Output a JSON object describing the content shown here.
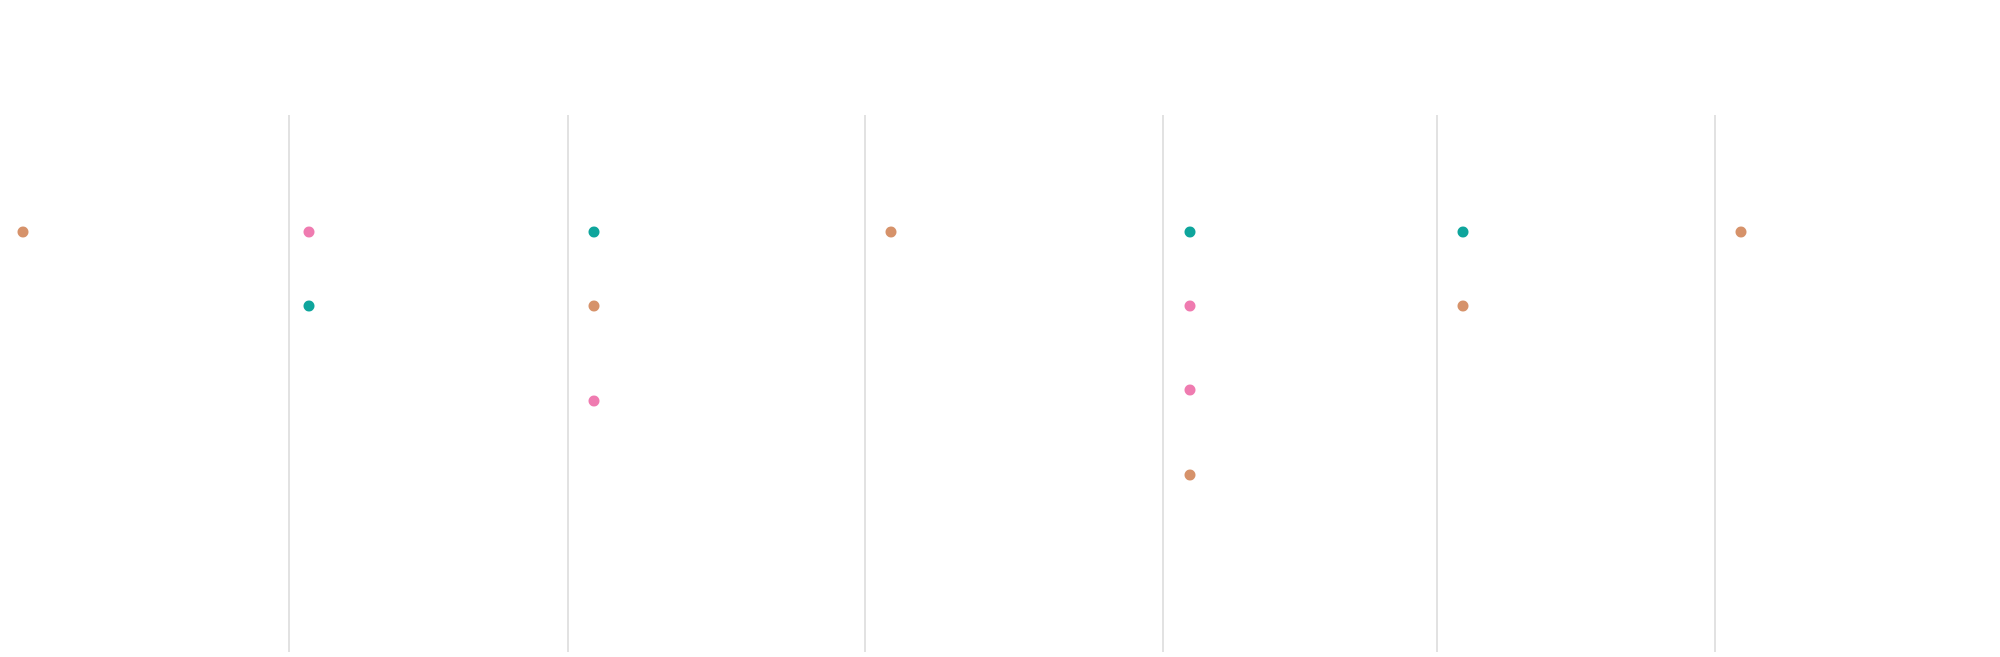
{
  "colors": {
    "background": "#ffffff",
    "divider": "#d9d9d9",
    "orange": "#d6926a",
    "pink": "#ef7bb0",
    "teal": "#0ea59c"
  },
  "columns": [
    {
      "dots": [
        "orange"
      ]
    },
    {
      "dots": [
        "pink",
        "teal"
      ]
    },
    {
      "dots": [
        "teal",
        "orange",
        "pink"
      ]
    },
    {
      "dots": [
        "orange"
      ]
    },
    {
      "dots": [
        "teal",
        "pink",
        "pink",
        "orange"
      ]
    },
    {
      "dots": [
        "teal",
        "orange"
      ]
    },
    {
      "dots": [
        "orange"
      ]
    }
  ]
}
